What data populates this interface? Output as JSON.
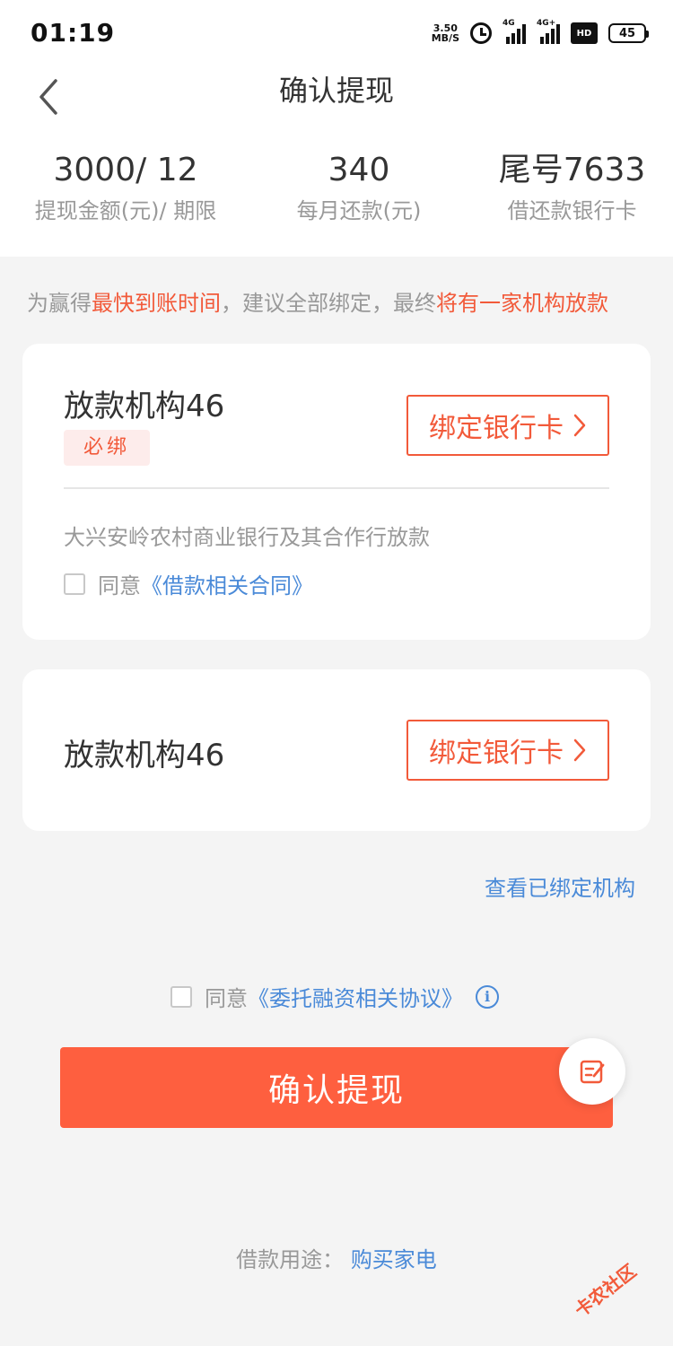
{
  "status_bar": {
    "time": "01:19",
    "net_speed_value": "3.50",
    "net_speed_unit": "MB/S",
    "signal1_label": "4G",
    "signal2_label": "4G+",
    "hd_label": "HD",
    "battery": "45"
  },
  "header": {
    "title": "确认提现",
    "back_icon": "chevron-left-icon"
  },
  "summary": {
    "amount_value": "3000/ 12",
    "amount_label": "提现金额(元)/ 期限",
    "monthly_value": "340",
    "monthly_label": "每月还款(元)",
    "card_value": "尾号7633",
    "card_label": "借还款银行卡"
  },
  "tip": {
    "part1": "为赢得",
    "highlight1": "最快到账时间",
    "part2": "，建议全部绑定，最终",
    "highlight2": "将有一家机构放款"
  },
  "cards": [
    {
      "name": "放款机构46",
      "badge": "必绑",
      "button_label": "绑定银行卡",
      "description": "大兴安岭农村商业银行及其合作行放款",
      "agree_prefix": "同意",
      "agree_link": "《借款相关合同》"
    },
    {
      "name": "放款机构46",
      "button_label": "绑定银行卡"
    }
  ],
  "view_bound_link": "查看已绑定机构",
  "agreement": {
    "prefix": "同意",
    "link": "《委托融资相关协议》",
    "info_icon": "info-icon"
  },
  "confirm_button": "确认提现",
  "float_button_icon": "edit-note-icon",
  "purpose": {
    "label": "借款用途：",
    "value": "购买家电"
  },
  "watermark": "卡农社区",
  "colors": {
    "accent": "#fe5f3f",
    "highlight": "#f25a3a",
    "link": "#4a8ad8",
    "background": "#f4f4f4"
  }
}
